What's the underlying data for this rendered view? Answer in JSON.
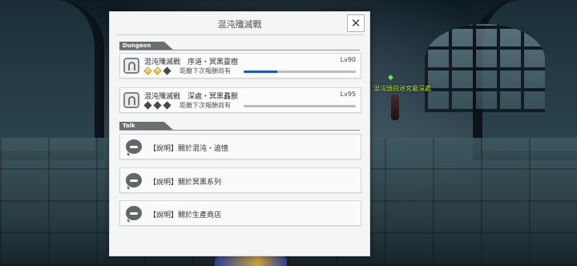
{
  "dialog": {
    "title": "混沌殲滅戰",
    "close_label": "✕"
  },
  "sections": {
    "dungeon_label": "Dungeon",
    "talk_label": "Talk"
  },
  "dungeons": [
    {
      "name": "混沌殲滅戰　序道・冥黑靈樹",
      "level": "Lv90",
      "reward_text": "距離下次報酬尚有",
      "gems": [
        "gold",
        "gold",
        "dark"
      ],
      "progress": 0.3
    },
    {
      "name": "混沌殲滅戰　深處・冥黑矗獸",
      "level": "Lv95",
      "reward_text": "距離下次報酬尚有",
      "gems": [
        "dark",
        "dark",
        "dark"
      ],
      "progress": 0
    }
  ],
  "talk_items": [
    {
      "label": "【說明】關於混沌・追憶"
    },
    {
      "label": "【說明】關於冥黑系列"
    },
    {
      "label": "【說明】關於生產商店"
    }
  ],
  "world": {
    "npc_label": "混沌頭目迷宮最深處"
  },
  "colors": {
    "progress_fill": "#1f56c9",
    "gem_gold": "#e8a91a",
    "npc_label": "#c8f04a"
  }
}
